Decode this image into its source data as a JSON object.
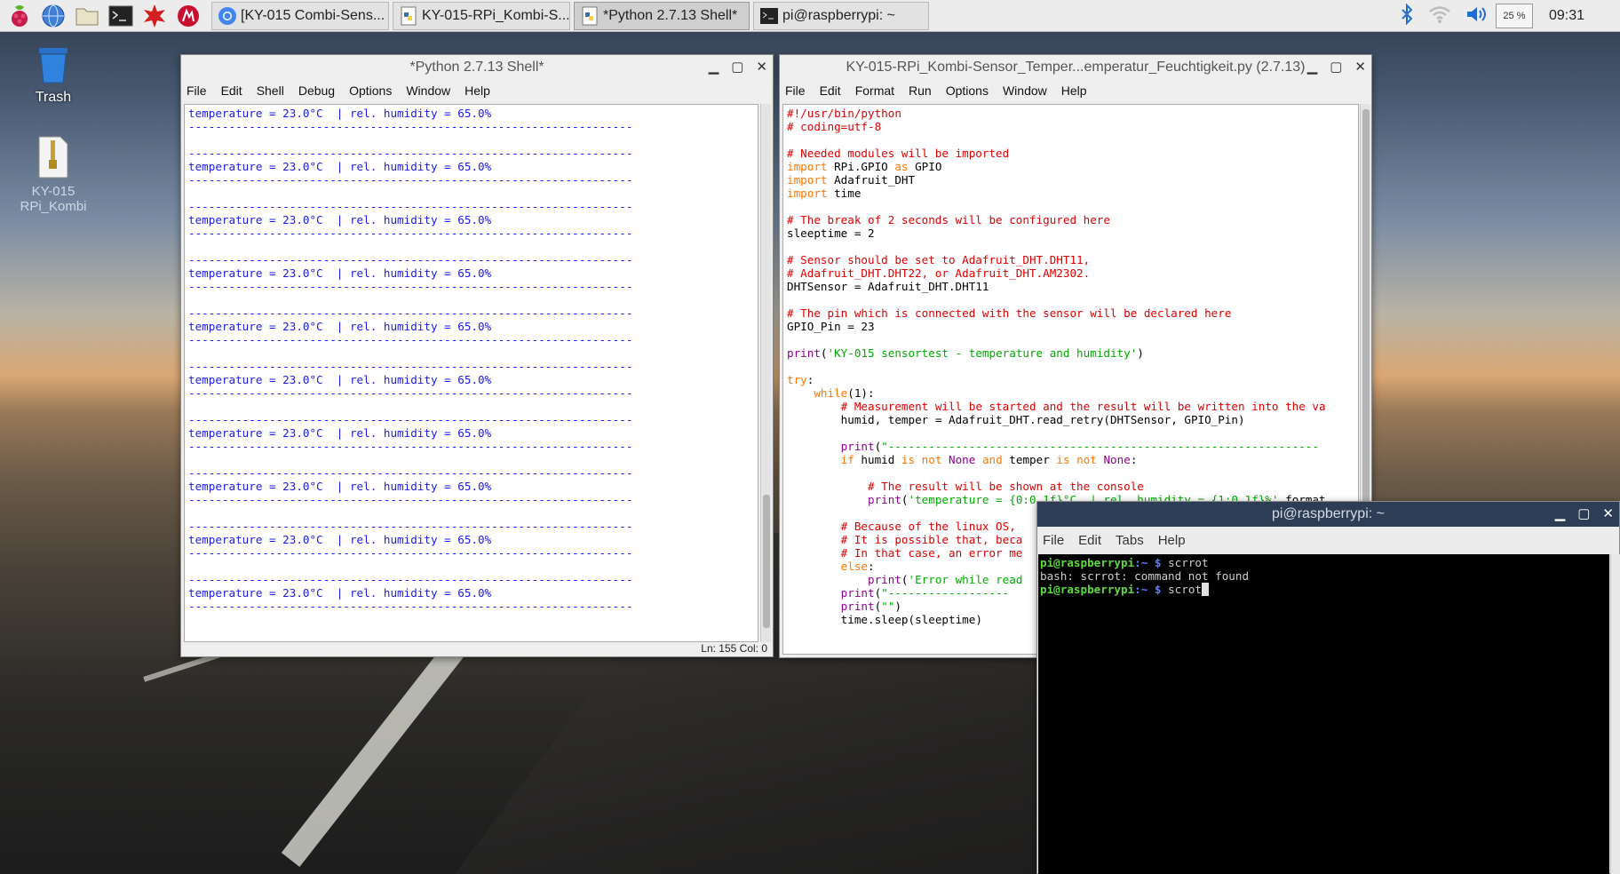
{
  "taskbar": {
    "tasks": [
      {
        "label": "[KY-015 Combi-Sens...",
        "icon": "chromium-icon"
      },
      {
        "label": "KY-015-RPi_Kombi-S...",
        "icon": "python-file-icon"
      },
      {
        "label": "*Python 2.7.13 Shell*",
        "icon": "python-file-icon"
      },
      {
        "label": "pi@raspberrypi: ~",
        "icon": "terminal-icon"
      }
    ],
    "cpu": "25 %",
    "clock": "09:31"
  },
  "desktop": {
    "trash_label": "Trash",
    "file_label": "KY-015\nRPi_Kombi"
  },
  "shell": {
    "title": "*Python 2.7.13 Shell*",
    "menu": [
      "File",
      "Edit",
      "Shell",
      "Debug",
      "Options",
      "Window",
      "Help"
    ],
    "reading": "temperature = 23.0°C  | rel. humidity = 65.0%",
    "separator": "------------------------------------------------------------------",
    "status": "Ln: 155  Col: 0"
  },
  "editor": {
    "title": "KY-015-RPi_Kombi-Sensor_Temper...emperatur_Feuchtigkeit.py (2.7.13)",
    "menu": [
      "File",
      "Edit",
      "Format",
      "Run",
      "Options",
      "Window",
      "Help"
    ],
    "code": {
      "l1": "#!/usr/bin/python",
      "l2": "# coding=utf-8",
      "l4": "# Needed modules will be imported",
      "l5a": "import",
      "l5b": " RPi.GPIO ",
      "l5c": "as",
      "l5d": " GPIO",
      "l6a": "import",
      "l6b": " Adafruit_DHT",
      "l7a": "import",
      "l7b": " time",
      "l9": "# The break of 2 seconds will be configured here",
      "l10": "sleeptime = 2",
      "l12": "# Sensor should be set to Adafruit_DHT.DHT11,",
      "l13": "# Adafruit_DHT.DHT22, or Adafruit_DHT.AM2302.",
      "l14": "DHTSensor = Adafruit_DHT.DHT11",
      "l16": "# The pin which is connected with the sensor will be declared here",
      "l17": "GPIO_Pin = 23",
      "l19a": "print",
      "l19b": "(",
      "l19c": "'KY-015 sensortest - temperature and humidity'",
      "l19d": ")",
      "l21": "try",
      "l22a": "while",
      "l22b": "(1):",
      "l23": "# Measurement will be started and the result will be written into the va",
      "l24": "humid, temper = Adafruit_DHT.read_retry(DHTSensor, GPIO_Pin)",
      "l26a": "print",
      "l26b": "(",
      "l26c": "\"----------------------------------------------------------------",
      "l27a": "if",
      "l27b": " humid ",
      "l27c": "is not",
      "l27d": " ",
      "l27e": "None",
      "l27f": " ",
      "l27g": "and",
      "l27h": " temper ",
      "l27i": "is not",
      "l27j": " ",
      "l27k": "None",
      "l27l": ":",
      "l29": "# The result will be shown at the console",
      "l30a": "print",
      "l30b": "(",
      "l30c": "'temperature = {0:0.1f}°C  | rel. humidity = {1:0.1f}%'",
      "l30d": ".format",
      "l32": "# Because of the linux OS,",
      "l33": "# It is possible that, beca",
      "l34": "# In that case, an error me",
      "l35": "else",
      "l36a": "print",
      "l36b": "(",
      "l36c": "'Error while read",
      "l37a": "print",
      "l37b": "(",
      "l37c": "\"------------------",
      "l38a": "print",
      "l38b": "(",
      "l38c": "\"\"",
      "l38d": ")",
      "l39": "time.sleep(sleeptime)"
    }
  },
  "terminal": {
    "title": "pi@raspberrypi: ~",
    "menu": [
      "File",
      "Edit",
      "Tabs",
      "Help"
    ],
    "prompt_user": "pi@raspberrypi",
    "prompt_path": ":~ $",
    "cmd1": " scrrot",
    "out1": "bash: scrrot: command not found",
    "cmd2": " scrot"
  }
}
